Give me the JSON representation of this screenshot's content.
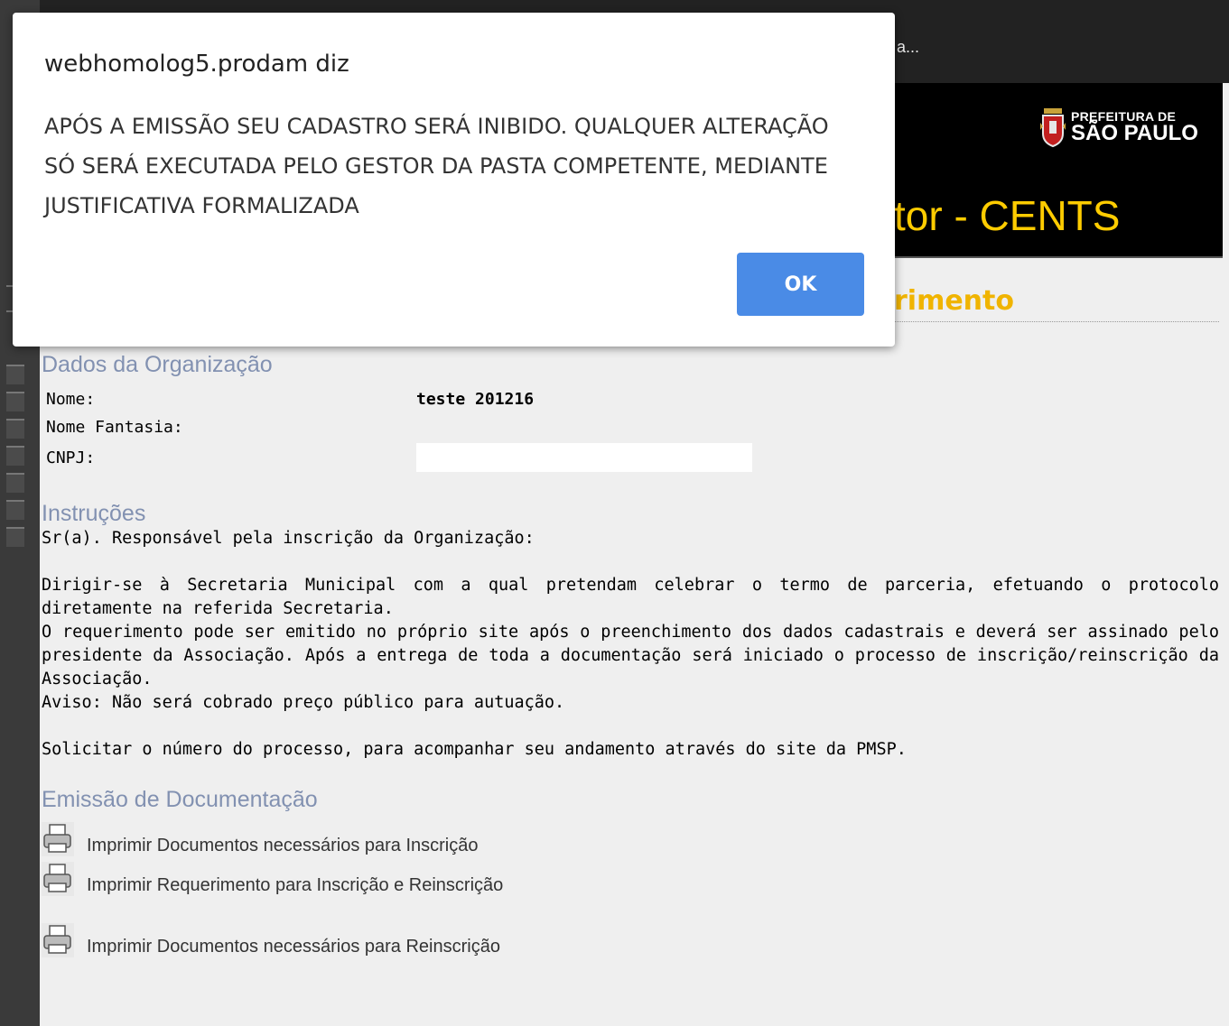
{
  "browser": {
    "title_tail": "a..."
  },
  "header": {
    "logo": {
      "line1": "PREFEITURA DE",
      "line2": "SÃO PAULO"
    },
    "system_title_tail": "tor - CENTS",
    "section_title_tail": "rimento"
  },
  "organization": {
    "heading": "Dados da Organização",
    "fields": [
      {
        "label": "Nome:",
        "value": "teste 201216"
      },
      {
        "label": "Nome Fantasia:",
        "value": ""
      },
      {
        "label": "CNPJ:",
        "value": ""
      }
    ]
  },
  "instructions": {
    "heading": "Instruções",
    "greeting": "Sr(a). Responsável pela inscrição da Organização:",
    "p1": "Dirigir-se à Secretaria Municipal com a qual pretendam celebrar o termo de parceria, efetuando o protocolo diretamente na referida Secretaria.",
    "p2": "O requerimento pode ser emitido no próprio site após o preenchimento dos dados cadastrais e deverá ser assinado pelo presidente da Associação. Após a entrega de toda a documentação será iniciado o processo de inscrição/reinscrição da Associação.",
    "p3": "Aviso: Não será cobrado preço público para autuação.",
    "p4": "Solicitar o número do processo, para acompanhar seu andamento através do site da PMSP."
  },
  "documentation": {
    "heading": "Emissão de Documentação",
    "links": [
      "Imprimir Documentos necessários para Inscrição",
      "Imprimir Requerimento para Inscrição e Reinscrição",
      "Imprimir Documentos necessários para Reinscrição"
    ]
  },
  "dialog": {
    "title": "webhomolog5.prodam diz",
    "message": "APÓS A EMISSÃO SEU CADASTRO SERÁ INIBIDO. QUALQUER ALTERAÇÃO SÓ SERÁ EXECUTADA PELO GESTOR DA PASTA COMPETENTE, MEDIANTE JUSTIFICATIVA FORMALIZADA",
    "ok_label": "OK"
  },
  "colors": {
    "accent_yellow": "#ffcc00",
    "heading_blue": "#8291b1",
    "ok_button": "#4a8be6"
  }
}
